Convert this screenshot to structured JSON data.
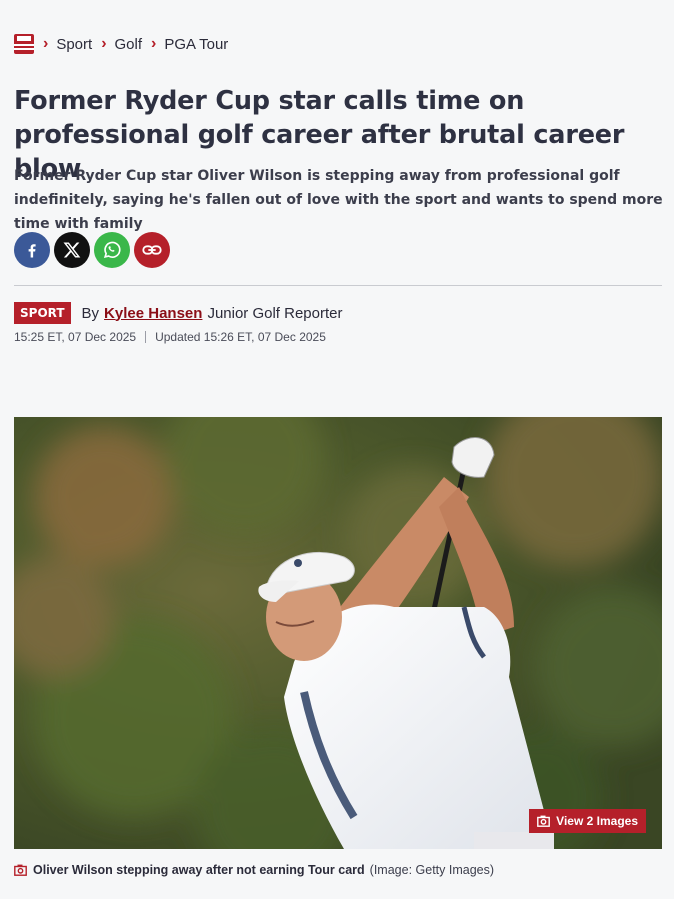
{
  "breadcrumb": {
    "items": [
      "Sport",
      "Golf",
      "PGA Tour"
    ]
  },
  "article": {
    "headline": "Former Ryder Cup star calls time on professional golf career after brutal career blow",
    "standfirst": "Former Ryder Cup star Oliver Wilson is stepping away from professional golf indefinitely, saying he's fallen out of love with the sport and wants to spend more time with family",
    "section_tag": "SPORT",
    "by_label": "By",
    "author": "Kylee Hansen",
    "author_role": "Junior Golf Reporter",
    "published": "15:25 ET, 07 Dec 2025",
    "updated": "Updated 15:26 ET, 07 Dec 2025"
  },
  "share": {
    "icons": [
      "facebook-icon",
      "x-icon",
      "whatsapp-icon",
      "link-icon"
    ]
  },
  "media": {
    "view_images_label": "View 2 Images",
    "caption": "Oliver Wilson stepping away after not earning Tour card",
    "credit": "(Image: Getty Images)"
  },
  "colors": {
    "brand_red": "#b5202a",
    "author_link": "#8b0e17",
    "headline": "#2e3142",
    "background": "#f6f7f8"
  }
}
